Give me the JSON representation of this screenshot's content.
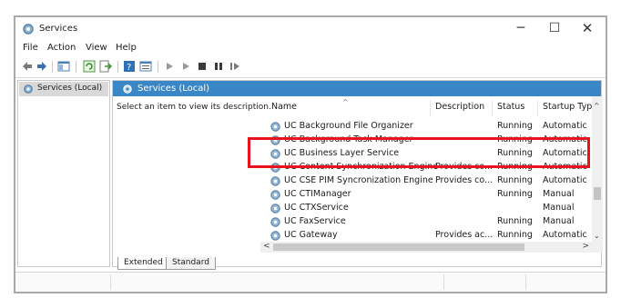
{
  "window": {
    "title": "Services",
    "controls": {
      "minimize": "─",
      "maximize": "☐",
      "close": "✕"
    }
  },
  "menu": [
    "File",
    "Action",
    "View",
    "Help"
  ],
  "toolbar_icons": [
    "back-arrow-icon",
    "forward-arrow-icon",
    "show-hide-tree-icon",
    "refresh-icon",
    "export-list-icon",
    "help-icon",
    "properties-icon",
    "start-service-icon",
    "start-service-alt-icon",
    "stop-service-icon",
    "pause-service-icon",
    "resume-service-icon"
  ],
  "tree": {
    "selected": "Services (Local)"
  },
  "main": {
    "header": "Services (Local)",
    "prompt": "Select an item to view its description."
  },
  "columns": {
    "name": "Name",
    "sort_indicator": "^",
    "description": "Description",
    "status": "Status",
    "startup_type": "Startup Type"
  },
  "rows": [
    {
      "name": "UC Background File Organizer",
      "description": "",
      "status": "Running",
      "startup_type": "Automatic"
    },
    {
      "name": "UC Background Task Manager",
      "description": "",
      "status": "Running",
      "startup_type": "Automatic"
    },
    {
      "name": "UC Business Layer Service",
      "description": "",
      "status": "Running",
      "startup_type": "Automatic"
    },
    {
      "name": "UC Content Synchronization Engine",
      "description": "Provides co...",
      "status": "Running",
      "startup_type": "Automatic"
    },
    {
      "name": "UC CSE PIM Syncronization Engine",
      "description": "Provides co...",
      "status": "Running",
      "startup_type": "Automatic"
    },
    {
      "name": "UC CTIManager",
      "description": "",
      "status": "Running",
      "startup_type": "Manual"
    },
    {
      "name": "UC CTXService",
      "description": "",
      "status": "",
      "startup_type": "Manual"
    },
    {
      "name": "UC FaxService",
      "description": "",
      "status": "Running",
      "startup_type": "Manual"
    },
    {
      "name": "UC Gateway",
      "description": "Provides ac...",
      "status": "Running",
      "startup_type": "Automatic"
    }
  ],
  "scroll": {
    "up": "^",
    "down": "⌄",
    "left": "<",
    "right": ">"
  },
  "tabs": [
    "Extended",
    "Standard"
  ],
  "colors": {
    "accent": "#3a87c8",
    "highlight": "#e8131b",
    "selection": "#d9d9d9"
  }
}
